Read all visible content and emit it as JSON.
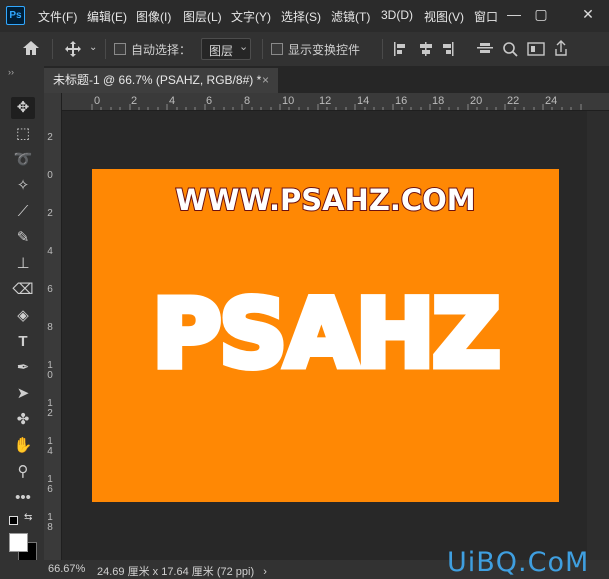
{
  "app": {
    "logo": "Ps"
  },
  "menu": [
    "文件(F)",
    "编辑(E)",
    "图像(I)",
    "图层(L)",
    "文字(Y)",
    "选择(S)",
    "滤镜(T)",
    "3D(D)",
    "视图(V)",
    "窗口"
  ],
  "window_controls": {
    "minimize": "—",
    "maximize": "▢",
    "close": "✕"
  },
  "options": {
    "auto_select_label": "自动选择：",
    "layer_select_value": "图层",
    "show_transform_label": "显示变换控件"
  },
  "document": {
    "tab_title": "未标题-1 @ 66.7% (PSAHZ, RGB/8#) *",
    "close": "×"
  },
  "ruler": {
    "h_labels": [
      "0",
      "2",
      "4",
      "6",
      "8",
      "10",
      "12",
      "14",
      "16",
      "18",
      "20",
      "22",
      "24"
    ],
    "v_labels": [
      "2",
      "0",
      "2",
      "4",
      "6",
      "8",
      "1\n0",
      "1\n2",
      "1\n4",
      "1\n6",
      "1\n8"
    ]
  },
  "canvas": {
    "background_color": "#ff8804",
    "url_text": "WWW.PSAHZ.COM",
    "big_text": "PSAHZ"
  },
  "status": {
    "zoom": "66.67%",
    "doc_info": "24.69 厘米 x 17.64 厘米 (72 ppi)",
    "arrow": "›"
  },
  "watermark": "UiBQ.CoM"
}
